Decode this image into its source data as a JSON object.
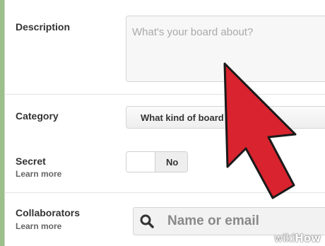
{
  "form": {
    "description": {
      "label": "Description",
      "placeholder": "What's your board about?"
    },
    "category": {
      "label": "Category",
      "selected": "What kind of board is it?"
    },
    "secret": {
      "label": "Secret",
      "learn_more": "Learn more",
      "toggle_value": "No"
    },
    "collaborators": {
      "label": "Collaborators",
      "learn_more": "Learn more",
      "search_placeholder": "Name or email",
      "icon": "search-icon"
    }
  },
  "overlay": {
    "arrow_color": "#d9232e",
    "arrow_outline": "#1a1a1a"
  },
  "watermark": {
    "prefix": "wiki",
    "suffix": "How"
  },
  "colors": {
    "background": "#9bc08a",
    "panel": "#ffffff"
  }
}
